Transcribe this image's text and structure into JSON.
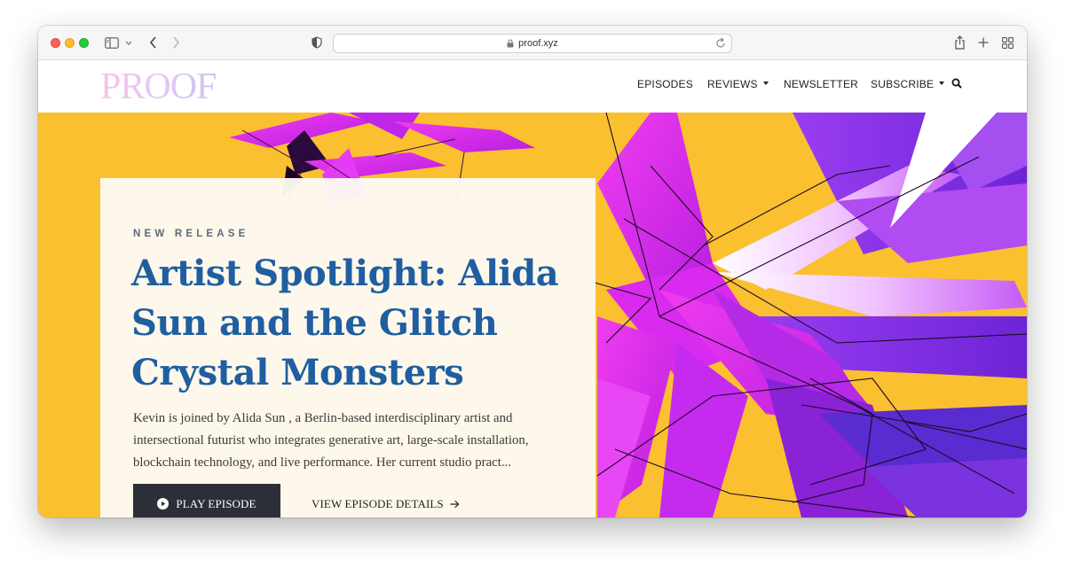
{
  "browser": {
    "url": "proof.xyz"
  },
  "site": {
    "logo": "PROOF",
    "nav": {
      "episodes": "EPISODES",
      "reviews": "REVIEWS",
      "newsletter": "NEWSLETTER",
      "subscribe": "SUBSCRIBE"
    }
  },
  "hero": {
    "eyebrow": "NEW RELEASE",
    "title": "Artist Spotlight: Alida Sun and the Glitch Crystal Monsters",
    "description": "Kevin is joined by Alida Sun , a Berlin-based interdisciplinary artist and intersectional futurist who integrates generative art, large-scale installation, blockchain technology, and live performance. Her current studio pract...",
    "play_label": "PLAY EPISODE",
    "details_label": "VIEW EPISODE DETAILS"
  },
  "colors": {
    "hero_background": "#fbc02f",
    "headline": "#1f5ea0",
    "button": "#2d2f38",
    "crystal_magenta": "#d41ff0",
    "crystal_violet": "#8a2ee6"
  },
  "icons": [
    "sidebar-icon",
    "chevron-down-icon",
    "back-icon",
    "forward-icon",
    "shield-icon",
    "lock-icon",
    "reload-icon",
    "share-icon",
    "new-tab-icon",
    "tab-overview-icon",
    "search-icon",
    "play-icon",
    "arrow-right-icon"
  ]
}
